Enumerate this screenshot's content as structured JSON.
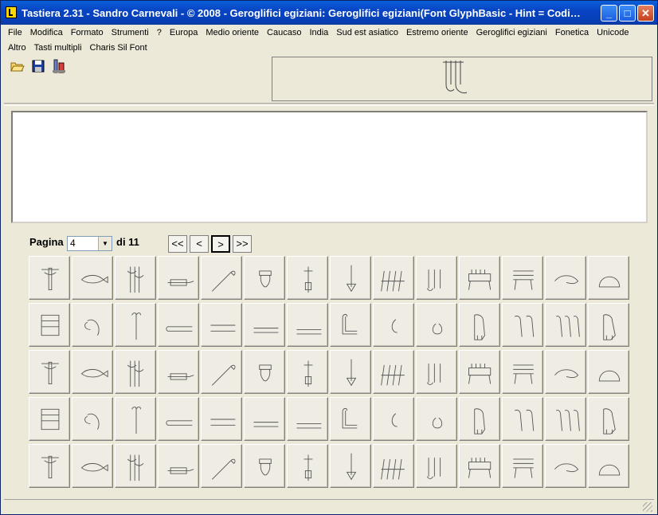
{
  "window": {
    "title": "Tastiera 2.31 - Sandro Carnevali - ©  2008 - Geroglifici egiziani: Geroglifici egiziani(Font GlyphBasic - Hint = Codi…",
    "controls": {
      "minimize": "_",
      "maximize": "□",
      "close": "✕"
    }
  },
  "menu": {
    "row1": [
      "File",
      "Modifica",
      "Formato",
      "Strumenti",
      "?",
      "Europa",
      "Medio oriente",
      "Caucaso",
      "India",
      "Sud est asiatico",
      "Estremo oriente",
      "Geroglifici egiziani",
      "Fonetica",
      "Unicode"
    ],
    "row2": [
      "Altro",
      "Tasti multipli",
      "Charis Sil Font"
    ]
  },
  "toolbar": {
    "icons": [
      "open-folder-icon",
      "save-disk-icon",
      "keyboard-settings-icon"
    ]
  },
  "pager": {
    "label": "Pagina",
    "current": "4",
    "of_label": "di 11",
    "first": "<<",
    "prev": "<",
    "next": ">",
    "last": ">>"
  },
  "glyphs": {
    "rows": [
      [
        "branch-glyph",
        "fish-glyph",
        "plant-bundle-glyph",
        "sledge-glyph",
        "reed-glyph",
        "pot-glyph",
        "sistrum-glyph",
        "arrow-glyph",
        "strokes-glyph",
        "flowers-glyph",
        "comb-glyph",
        "stand-glyph",
        "stand2-glyph",
        "curve-glyph"
      ],
      [
        "vessel-glyph",
        "wing-glyph",
        "staff-glyph",
        "bar-glyph",
        "bar2-glyph",
        "bar3-glyph",
        "bar4-glyph",
        "loop-glyph",
        "small-curl-glyph",
        "small-pot-glyph",
        "vulture-glyph",
        "two-vultures-glyph",
        "three-vultures-glyph",
        "falcon-glyph"
      ],
      [
        "falcon2-glyph",
        "falcon3-glyph",
        "falcon-perch-glyph",
        "falcon-boat-glyph",
        "falcon-standard-glyph",
        "falcon-nest-glyph",
        "falcon-sun-glyph",
        "falcon-plants-glyph",
        "bird-lying-glyph",
        "bird-shrine-glyph",
        "bird-crown-glyph",
        "falcon4-glyph",
        "falcon5-glyph",
        "falcon-basket-glyph"
      ],
      [
        "owl-glyph",
        "two-owls-glyph",
        "owl-arm-glyph",
        "owl-bread-glyph",
        "ibis-crest-glyph",
        "swallow-glyph",
        "bird-crest-glyph",
        "bird-flying-glyph",
        "ibis-glyph",
        "ibis-standard-glyph",
        "ibis2-glyph",
        "bird-fish-glyph",
        "heron-glyph",
        "heron2-glyph"
      ],
      [
        "three-birds-glyph",
        "heron3-glyph",
        "bird-perch-glyph",
        "stork-glyph",
        "flamingo-glyph",
        "spoonbill-glyph",
        "crow-glyph",
        "sparrow-glyph",
        "goose-glyph",
        "goose2-glyph",
        "lotus-glyph",
        "panels-glyph",
        "feather-glyph",
        "loom-glyph"
      ]
    ]
  },
  "colors": {
    "titlebar": "#0845c4",
    "face": "#ece9d8",
    "glyph_stroke": "#555555"
  }
}
